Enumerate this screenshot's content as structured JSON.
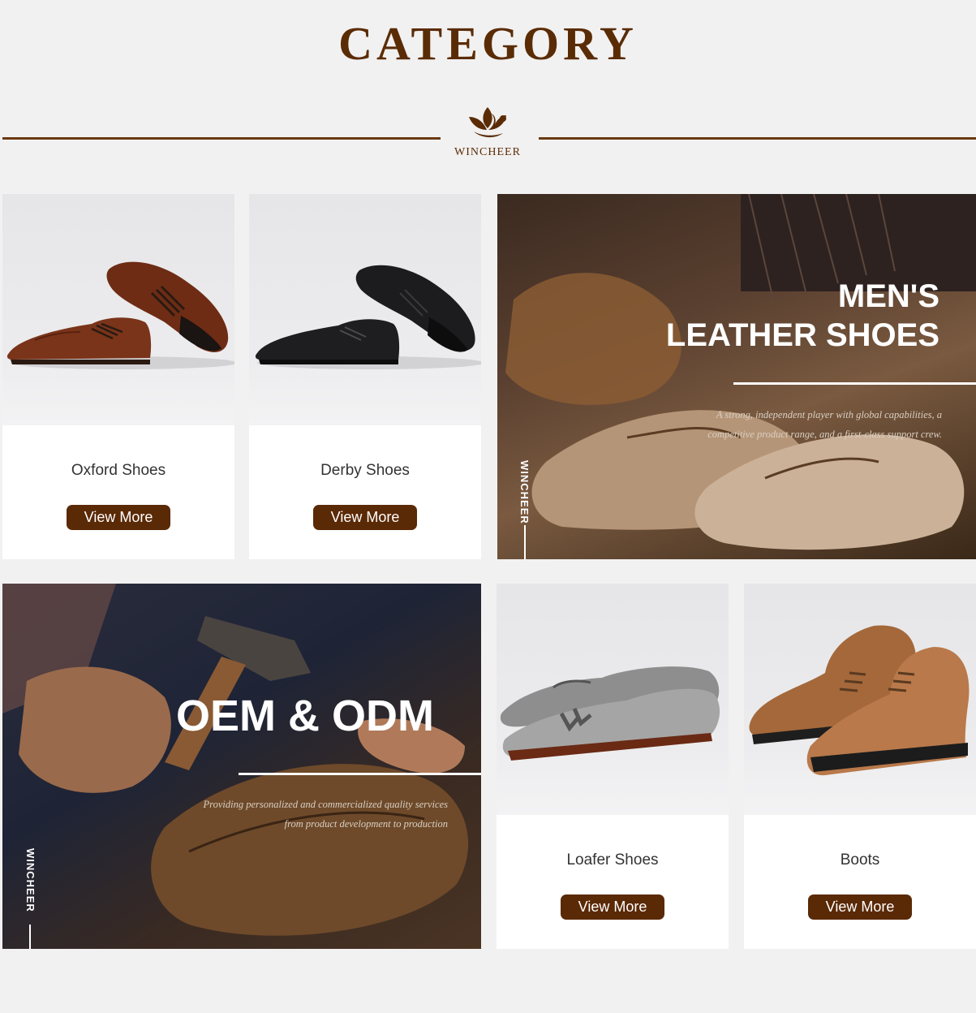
{
  "header": {
    "title": "CATEGORY",
    "logo_text": "WINCHEER"
  },
  "colors": {
    "brand_brown": "#5a2906",
    "page_background": "#f2f1f1"
  },
  "products": [
    {
      "name": "Oxford Shoes",
      "button": "View More"
    },
    {
      "name": "Derby Shoes",
      "button": "View More"
    },
    {
      "name": "Loafer Shoes",
      "button": "View More"
    },
    {
      "name": "Boots",
      "button": "View More"
    }
  ],
  "mens_banner": {
    "title_line1": "MEN'S",
    "title_line2": "LEATHER SHOES",
    "desc_line1": "A strong, independent player with global capabilities, a",
    "desc_line2": "competitive product range, and a first-class support crew.",
    "vertical_label": "WINCHEER"
  },
  "oem_banner": {
    "title": "OEM & ODM",
    "desc_line1": "Providing personalized and commercialized quality services",
    "desc_line2": "from product development to production",
    "vertical_label": "WINCHEER"
  }
}
